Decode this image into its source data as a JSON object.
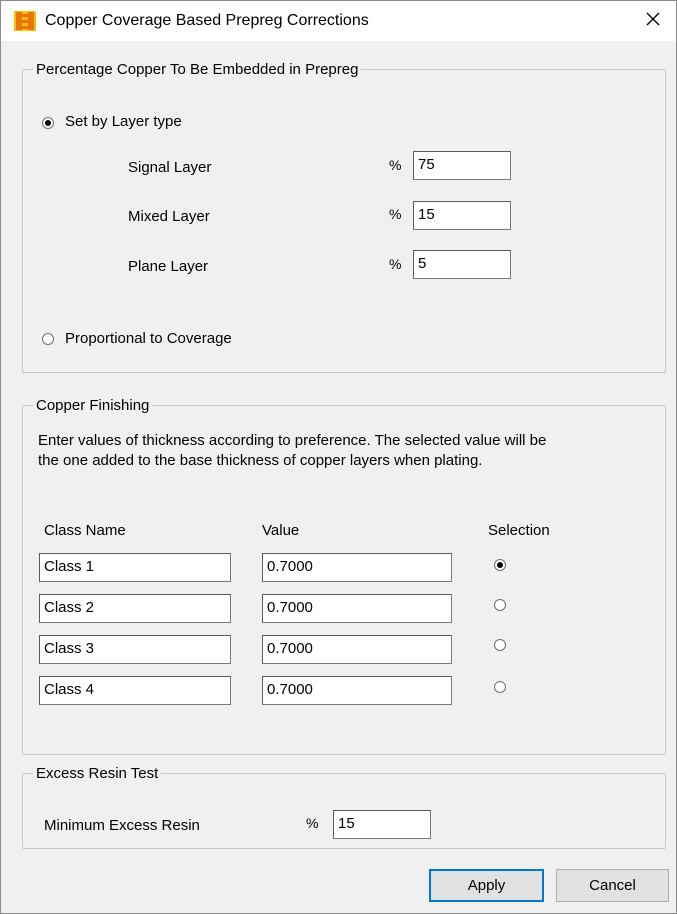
{
  "window": {
    "title": "Copper Coverage Based Prepreg Corrections",
    "close_glyph": "✕"
  },
  "prepreg": {
    "legend": "Percentage Copper To Be Embedded in Prepreg",
    "option_layer_type": {
      "label": "Set by Layer type",
      "checked": true
    },
    "rows": [
      {
        "label": "Signal Layer",
        "percent_sign": "%",
        "value": "75"
      },
      {
        "label": "Mixed Layer",
        "percent_sign": "%",
        "value": "15"
      },
      {
        "label": "Plane Layer",
        "percent_sign": "%",
        "value": "5"
      }
    ],
    "option_proportional": {
      "label": "Proportional to Coverage",
      "checked": false
    }
  },
  "finishing": {
    "legend": "Copper Finishing",
    "description_line1": "Enter values of thickness according to preference. The selected value will be",
    "description_line2": "the one added to the base thickness of copper layers when plating.",
    "columns": {
      "class_name": "Class Name",
      "value": "Value",
      "selection": "Selection"
    },
    "rows": [
      {
        "class_name": "Class 1",
        "value": "0.7000",
        "selected": true
      },
      {
        "class_name": "Class 2",
        "value": "0.7000",
        "selected": false
      },
      {
        "class_name": "Class 3",
        "value": "0.7000",
        "selected": false
      },
      {
        "class_name": "Class 4",
        "value": "0.7000",
        "selected": false
      }
    ]
  },
  "resin": {
    "legend": "Excess Resin Test",
    "label": "Minimum Excess Resin",
    "percent_sign": "%",
    "value": "15"
  },
  "buttons": {
    "apply": "Apply",
    "cancel": "Cancel"
  },
  "colors": {
    "icon_orange": "#e8730c",
    "icon_yellow": "#f5c400",
    "default_button_border": "#0078d7"
  }
}
